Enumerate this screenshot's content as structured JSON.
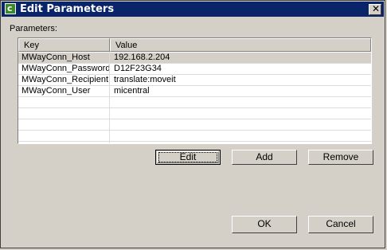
{
  "window": {
    "title": "Edit Parameters",
    "icon": "app-icon",
    "close_icon": "close-icon"
  },
  "params_label": "Parameters:",
  "table": {
    "columns": [
      "Key",
      "Value"
    ],
    "rows": [
      {
        "key": "MWayConn_Host",
        "value": "192.168.2.204",
        "selected": true
      },
      {
        "key": "MWayConn_Password",
        "value": "D12F23G34",
        "selected": false
      },
      {
        "key": "MWayConn_Recipient",
        "value": "translate:moveit",
        "selected": false
      },
      {
        "key": "MWayConn_User",
        "value": "micentral",
        "selected": false
      }
    ]
  },
  "buttons": {
    "edit": "Edit",
    "add": "Add",
    "remove": "Remove",
    "ok": "OK",
    "cancel": "Cancel"
  }
}
